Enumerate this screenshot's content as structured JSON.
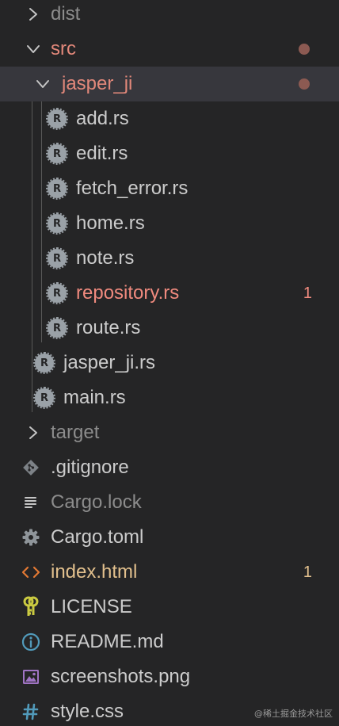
{
  "explorer": {
    "items": [
      {
        "label": "dist"
      },
      {
        "label": "src"
      },
      {
        "label": "jasper_ji"
      },
      {
        "label": "add.rs"
      },
      {
        "label": "edit.rs"
      },
      {
        "label": "fetch_error.rs"
      },
      {
        "label": "home.rs"
      },
      {
        "label": "note.rs"
      },
      {
        "label": "repository.rs",
        "problems": "1"
      },
      {
        "label": "route.rs"
      },
      {
        "label": "jasper_ji.rs"
      },
      {
        "label": "main.rs"
      },
      {
        "label": "target"
      },
      {
        "label": ".gitignore"
      },
      {
        "label": "Cargo.lock"
      },
      {
        "label": "Cargo.toml"
      },
      {
        "label": "index.html",
        "problems": "1"
      },
      {
        "label": "LICENSE"
      },
      {
        "label": "README.md"
      },
      {
        "label": "screenshots.png"
      },
      {
        "label": "style.css"
      }
    ]
  },
  "icons": {
    "chevron_right": "chevron-right-icon",
    "chevron_down": "chevron-down-icon",
    "rust_file": "rust-file-icon",
    "git": "git-icon",
    "lock_file": "lines-icon",
    "toml": "gear-icon",
    "html": "code-brackets-icon",
    "license": "key-icon",
    "readme": "info-icon",
    "image": "image-icon",
    "css": "hash-icon"
  },
  "colors": {
    "background": "#252526",
    "selected_row": "#37373d",
    "text": "#cccccc",
    "ignored_text": "#8c8c8c",
    "modified_text": "#e2887a",
    "error_text": "#f08a7e",
    "warning_text": "#e2c08d",
    "modified_dot": "#8c5a52"
  },
  "watermark": "@稀土掘金技术社区"
}
